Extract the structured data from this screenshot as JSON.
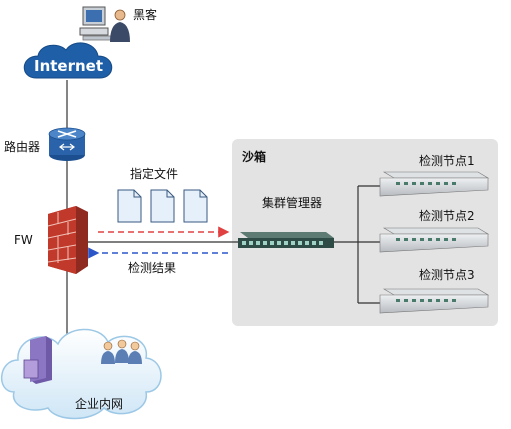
{
  "labels": {
    "hacker": "黑客",
    "internet": "Internet",
    "router": "路由器",
    "firewall": "FW",
    "sandbox": "沙箱",
    "cluster_manager": "集群管理器",
    "specified_files": "指定文件",
    "detection_results": "检测结果",
    "node1": "检测节点1",
    "node2": "检测节点2",
    "node3": "检测节点3",
    "intranet": "企业内网"
  },
  "colors": {
    "sandbox_bg": "#e3e3e3",
    "internet_blue": "#1f5fa8",
    "firewall_red": "#c0392b",
    "arrow_red": "#e04040",
    "arrow_blue": "#2c55c8",
    "switch_dark": "#2f4b45",
    "node_gray": "#c9cdd1"
  },
  "icons": [
    "computer-icon",
    "person-icon",
    "cloud-icon",
    "router-icon",
    "firewall-icon",
    "document-icon",
    "switch-icon",
    "server-icon",
    "users-icon"
  ]
}
